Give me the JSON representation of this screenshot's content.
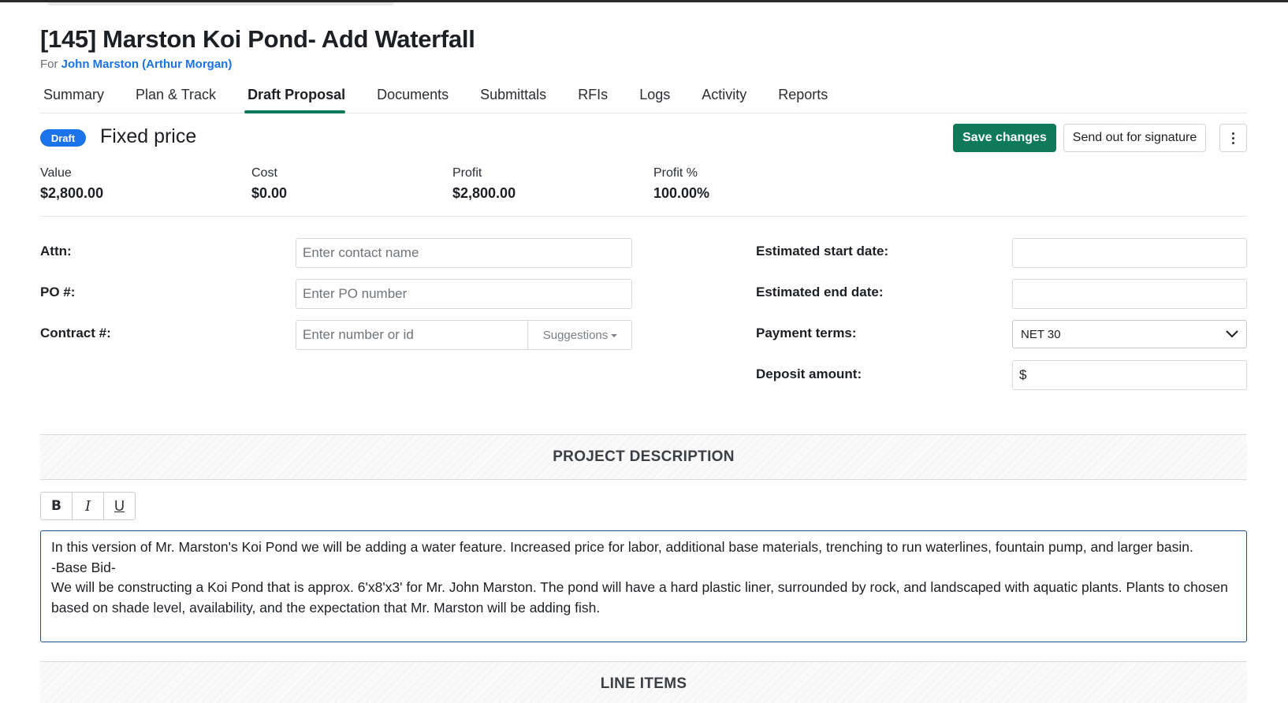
{
  "project": {
    "title": "[145] Marston Koi Pond- Add Waterfall",
    "for_prefix": "For",
    "client": "John Marston (Arthur Morgan)"
  },
  "tabs": [
    {
      "label": "Summary",
      "active": false
    },
    {
      "label": "Plan & Track",
      "active": false
    },
    {
      "label": "Draft Proposal",
      "active": true
    },
    {
      "label": "Documents",
      "active": false
    },
    {
      "label": "Submittals",
      "active": false
    },
    {
      "label": "RFIs",
      "active": false
    },
    {
      "label": "Logs",
      "active": false
    },
    {
      "label": "Activity",
      "active": false
    },
    {
      "label": "Reports",
      "active": false
    }
  ],
  "proposal": {
    "status_badge": "Draft",
    "pricing_type": "Fixed price",
    "save_label": "Save changes",
    "send_label": "Send out for signature"
  },
  "stats": {
    "value_label": "Value",
    "value": "$2,800.00",
    "cost_label": "Cost",
    "cost": "$0.00",
    "profit_label": "Profit",
    "profit": "$2,800.00",
    "profit_pct_label": "Profit %",
    "profit_pct": "100.00%"
  },
  "form": {
    "attn_label": "Attn:",
    "attn_placeholder": "Enter contact name",
    "po_label": "PO #:",
    "po_placeholder": "Enter PO number",
    "contract_label": "Contract #:",
    "contract_placeholder": "Enter number or id",
    "suggestions_label": "Suggestions",
    "start_label": "Estimated start date:",
    "end_label": "Estimated end date:",
    "terms_label": "Payment terms:",
    "terms_value": "NET 30",
    "deposit_label": "Deposit amount:",
    "deposit_prefix": "$"
  },
  "sections": {
    "description_title": "PROJECT DESCRIPTION",
    "line_items_title": "LINE ITEMS"
  },
  "editor": {
    "toolbar": {
      "bold": "B",
      "italic": "I",
      "underline": "U"
    },
    "lines": [
      "In this version of Mr. Marston's Koi Pond we will be adding a water feature. Increased price for labor, additional base materials, trenching to run waterlines, fountain pump, and larger basin.",
      "-Base Bid-",
      "We will be constructing a Koi Pond that is approx. 6'x8'x3' for Mr. John Marston. The pond will have a hard plastic liner, surrounded by rock, and landscaped with aquatic plants. Plants to chosen based on shade level, availability, and the expectation that Mr. Marston will be adding fish."
    ]
  },
  "colors": {
    "primary_green": "#0f7a5a",
    "badge_blue": "#1a73e8",
    "link_blue": "#1a73e8"
  },
  "icons": {
    "more": "vertical-ellipsis-icon",
    "dropdown": "chevron-down-icon",
    "suggestions_caret": "caret-down-icon"
  }
}
